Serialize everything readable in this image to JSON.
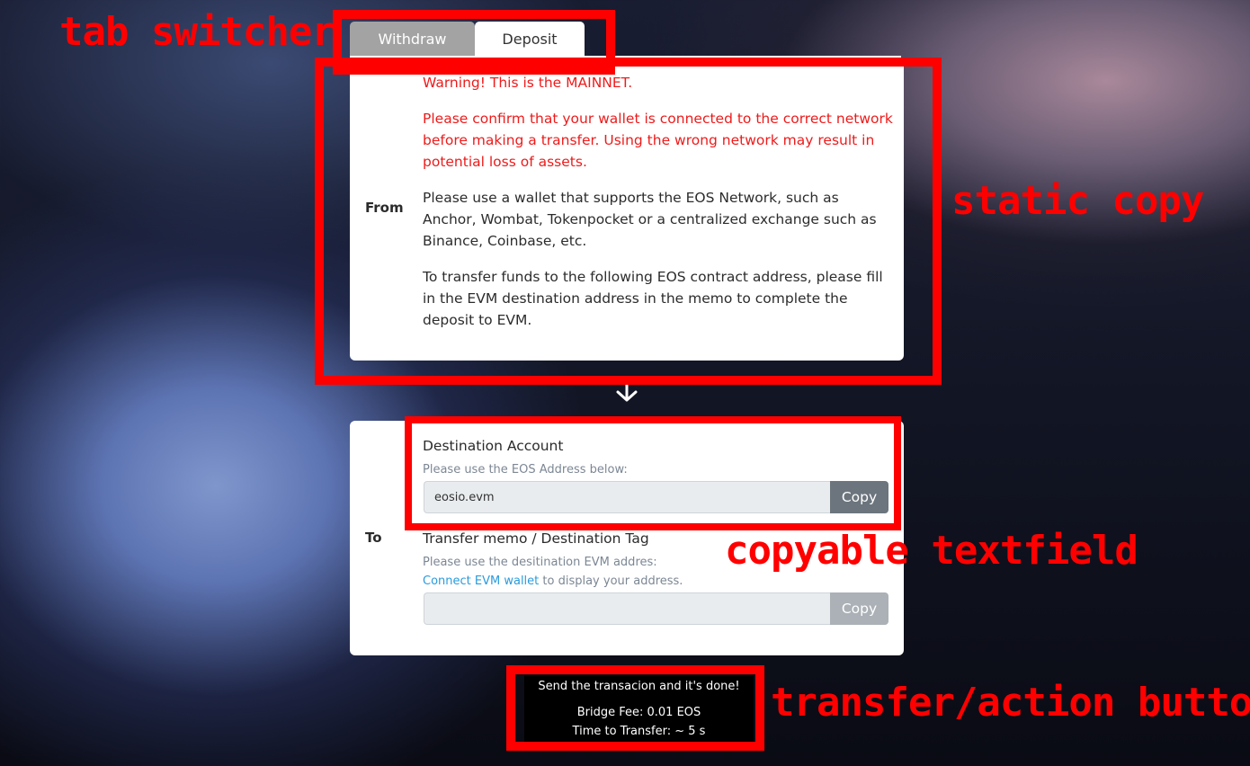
{
  "tabs": {
    "withdraw": "Withdraw",
    "deposit": "Deposit",
    "active": "Deposit"
  },
  "from": {
    "label": "From",
    "warning_title": "Warning! This is the MAINNET.",
    "warning_body": "Please confirm that your wallet is connected to the correct network before making a transfer. Using the wrong network may result in potential loss of assets.",
    "wallet_info": "Please use a wallet that supports the EOS Network, such as Anchor, Wombat, Tokenpocket or a centralized exchange such as Binance, Coinbase, etc.",
    "transfer_info": "To transfer funds to the following EOS contract address, please fill in the EVM destination address in the memo to complete the deposit to EVM."
  },
  "to": {
    "label": "To",
    "destination": {
      "title": "Destination Account",
      "hint": "Please use the EOS Address below:",
      "value": "eosio.evm",
      "copy_label": "Copy"
    },
    "memo": {
      "title": "Transfer memo / Destination Tag",
      "hint": "Please use the desitination EVM addres:",
      "connect_link": "Connect EVM wallet",
      "connect_suffix": " to display your address.",
      "value": "",
      "copy_label": "Copy"
    }
  },
  "send": {
    "status": "Send the transacion and it's done!",
    "fee": "Bridge Fee: 0.01 EOS",
    "time": "Time to Transfer: ~ 5 s"
  },
  "annotations": {
    "tab_switcher": "tab switcher",
    "static_copy": "static copy",
    "copyable_textfield": "copyable textfield",
    "action_button": "transfer/action button",
    "color": "#ff0000"
  },
  "icons": {
    "flow_arrow": "arrow-down-icon"
  }
}
